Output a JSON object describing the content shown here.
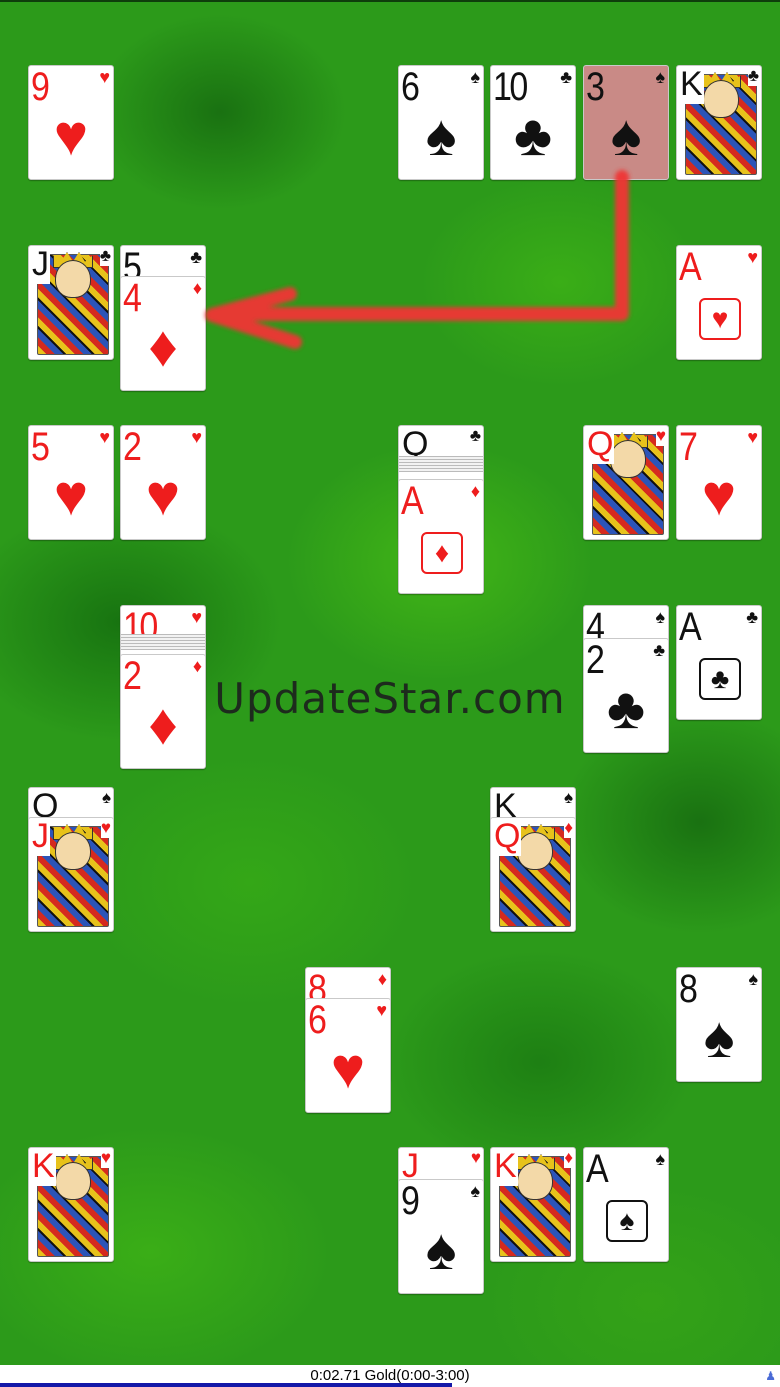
{
  "board": {
    "watermark": "UpdateStar.com"
  },
  "colors": {
    "felt": "#2c9a1a",
    "arrow": "#f03434",
    "highlight": "#c98a86",
    "progress": "#1418a8"
  },
  "cards": {
    "c1": {
      "rank": "9",
      "suit": "♥"
    },
    "c2": {
      "rank": "6",
      "suit": "♠"
    },
    "c3": {
      "rank": "10",
      "suit": "♣"
    },
    "c4": {
      "rank": "3",
      "suit": "♠"
    },
    "c5": {
      "rank": "K",
      "suit": "♣"
    },
    "c6": {
      "rank": "J",
      "suit": "♣"
    },
    "c7": {
      "rank": "5",
      "suit": "♣"
    },
    "c8": {
      "rank": "4",
      "suit": "♦"
    },
    "c9": {
      "rank": "A",
      "suit": "♥"
    },
    "c10": {
      "rank": "5",
      "suit": "♥"
    },
    "c11": {
      "rank": "2",
      "suit": "♥"
    },
    "c12": {
      "rank": "Q",
      "suit": "♣"
    },
    "c13": {
      "rank": "A",
      "suit": "♦"
    },
    "c14": {
      "rank": "Q",
      "suit": "♥"
    },
    "c15": {
      "rank": "7",
      "suit": "♥"
    },
    "c16": {
      "rank": "10",
      "suit": "♥"
    },
    "c17": {
      "rank": "2",
      "suit": "♦"
    },
    "c18": {
      "rank": "4",
      "suit": "♠"
    },
    "c19": {
      "rank": "2",
      "suit": "♣"
    },
    "c20": {
      "rank": "A",
      "suit": "♣"
    },
    "c21": {
      "rank": "Q",
      "suit": "♠"
    },
    "c22": {
      "rank": "J",
      "suit": "♥"
    },
    "c23": {
      "rank": "K",
      "suit": "♠"
    },
    "c24": {
      "rank": "Q",
      "suit": "♦"
    },
    "c25": {
      "rank": "8",
      "suit": "♦"
    },
    "c26": {
      "rank": "6",
      "suit": "♥"
    },
    "c27": {
      "rank": "8",
      "suit": "♠"
    },
    "c28": {
      "rank": "K",
      "suit": "♥"
    },
    "c29": {
      "rank": "J",
      "suit": "♥"
    },
    "c30": {
      "rank": "9",
      "suit": "♠"
    },
    "c31": {
      "rank": "K",
      "suit": "♦"
    },
    "c32": {
      "rank": "A",
      "suit": "♠"
    }
  },
  "status": {
    "text": "0:02.71 Gold(0:00-3:00)",
    "progress_fraction": 0.58
  }
}
